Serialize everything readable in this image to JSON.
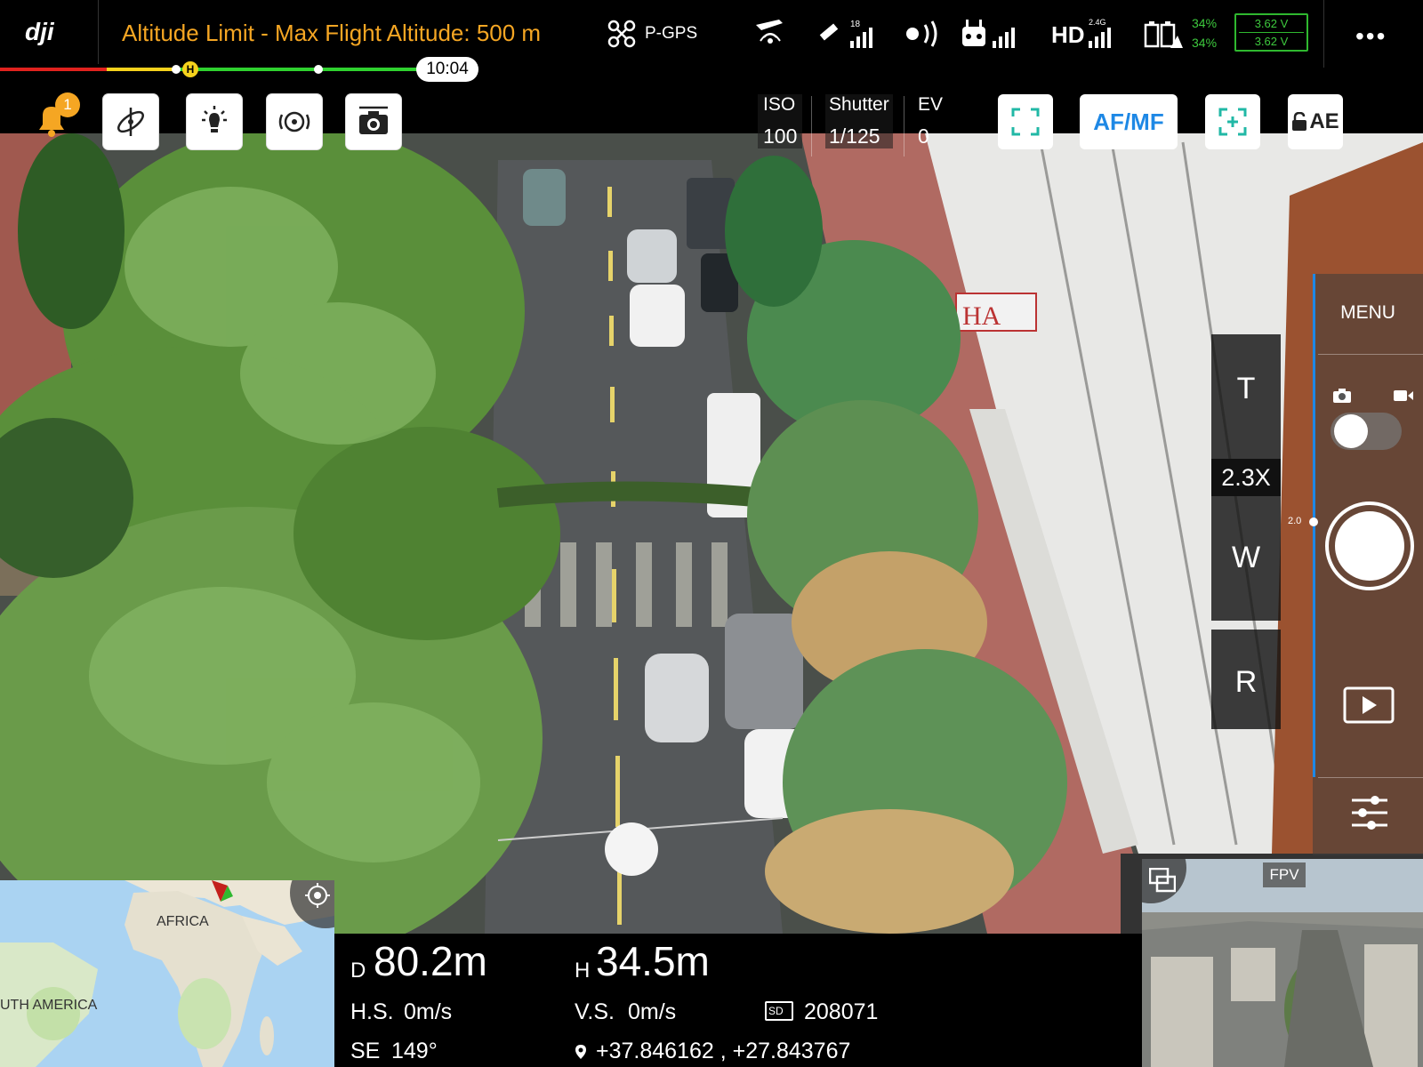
{
  "top_bar": {
    "altitude_warning": "Altitude Limit - Max Flight Altitude: 500 m",
    "flight_mode": "P-GPS",
    "gps_satellites": "18",
    "transmission_band": "2.4G",
    "video_link": "HD",
    "battery_percent_1": "34%",
    "battery_percent_2": "34%",
    "battery_voltage_1": "3.62 V",
    "battery_voltage_2": "3.62 V",
    "more_label": "•••"
  },
  "flight_bar": {
    "flight_time": "10:04",
    "home_marker": "H"
  },
  "notifications": {
    "count": "1"
  },
  "exposure": {
    "iso_label": "ISO",
    "iso_value": "100",
    "shutter_label": "Shutter",
    "shutter_value": "1/125",
    "ev_label": "EV",
    "ev_value": "0"
  },
  "camera_controls": {
    "focus_mode": "AF/MF",
    "ae_lock": "AE"
  },
  "zoom": {
    "tele_label": "T",
    "zoom_level": "2.3X",
    "wide_label": "W",
    "reset_label": "R"
  },
  "right_panel": {
    "menu_label": "MENU",
    "slider_value": "2.0"
  },
  "fpv": {
    "label": "FPV"
  },
  "telemetry": {
    "distance_prefix": "D",
    "distance_value": "80.2m",
    "height_prefix": "H",
    "height_value": "34.5m",
    "hs_label": "H.S.",
    "hs_value": "0m/s",
    "vs_label": "V.S.",
    "vs_value": "0m/s",
    "sd_label": "SD",
    "sd_count": "208071",
    "heading_label": "SE",
    "heading_value": "149°",
    "coordinates": "+37.846162 , +27.843767"
  },
  "minimap": {
    "label_africa": "AFRICA",
    "label_south_america": "UTH AMERICA"
  },
  "scene": {
    "sign_text": "HA"
  },
  "colors": {
    "warning": "#f5a623",
    "battery_green": "#3ec93e",
    "accent_blue": "#1e88e5",
    "teal_icon": "#21b8a6"
  },
  "icons": [
    "dji-logo",
    "drone-icon",
    "aircraft-signal-icon",
    "gps-satellite-icon",
    "wifi-signal-icon",
    "remote-controller-icon",
    "hd-signal-icon",
    "battery-icon",
    "bell-icon",
    "gimbal-icon",
    "light-icon",
    "intelligent-flight-icon",
    "camera-settings-icon",
    "focus-frame-icon",
    "center-focus-icon",
    "lock-icon",
    "photo-mode-icon",
    "video-mode-icon",
    "shutter-button",
    "playback-icon",
    "settings-sliders-icon",
    "recenter-icon",
    "swap-view-icon",
    "location-pin-icon",
    "sd-card-icon"
  ]
}
